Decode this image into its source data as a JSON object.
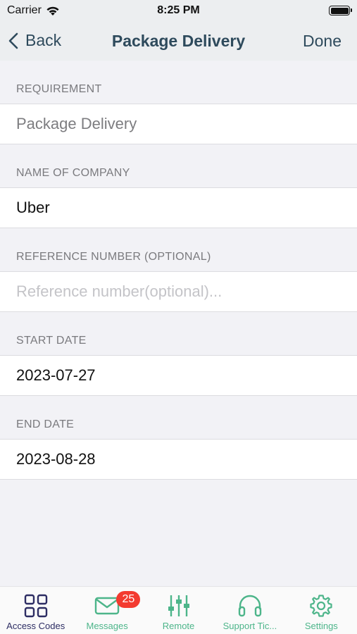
{
  "status_bar": {
    "carrier": "Carrier",
    "time": "8:25 PM"
  },
  "nav": {
    "back_label": "Back",
    "title": "Package Delivery",
    "done_label": "Done"
  },
  "form": {
    "requirement": {
      "label": "REQUIREMENT",
      "value": "Package Delivery"
    },
    "company": {
      "label": "NAME OF COMPANY",
      "value": "Uber"
    },
    "reference": {
      "label": "REFERENCE NUMBER (OPTIONAL)",
      "value": "",
      "placeholder": "Reference number(optional)..."
    },
    "start_date": {
      "label": "START DATE",
      "value": "2023-07-27"
    },
    "end_date": {
      "label": "END DATE",
      "value": "2023-08-28"
    }
  },
  "tabs": [
    {
      "label": "Access Codes",
      "icon": "grid-icon",
      "active": true
    },
    {
      "label": "Messages",
      "icon": "envelope-icon",
      "badge": "25"
    },
    {
      "label": "Remote",
      "icon": "sliders-icon"
    },
    {
      "label": "Support Tic...",
      "icon": "headphones-icon"
    },
    {
      "label": "Settings",
      "icon": "gear-icon"
    }
  ],
  "colors": {
    "nav_text": "#2e4a5c",
    "tab_active": "#2d2d63",
    "tab_inactive": "#4db58a",
    "badge": "#f33b30"
  }
}
